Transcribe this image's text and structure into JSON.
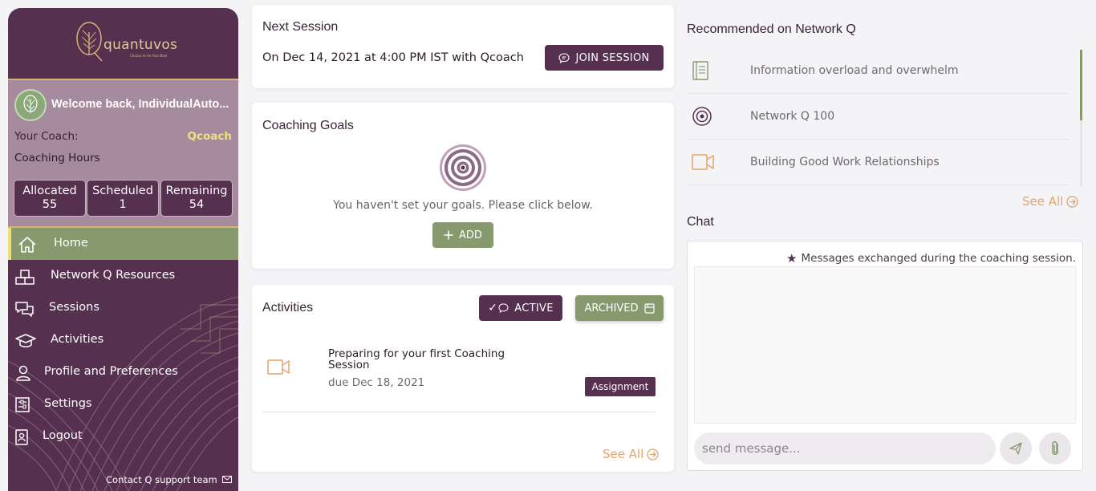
{
  "brand": {
    "name": "quantuvos",
    "tagline": "Choose to be Your Best"
  },
  "user": {
    "welcome": "Welcome back, IndividualAuto...",
    "coach_label": "Your Coach:",
    "coach_name": "Qcoach"
  },
  "hours": {
    "label": "Coaching Hours",
    "items": [
      {
        "label": "Allocated",
        "value": "55"
      },
      {
        "label": "Scheduled",
        "value": "1"
      },
      {
        "label": "Remaining",
        "value": "54"
      }
    ]
  },
  "nav": {
    "items": [
      {
        "label": "Home",
        "icon": "home-icon",
        "active": true
      },
      {
        "label": "Network Q Resources",
        "icon": "resources-icon",
        "active": false
      },
      {
        "label": "Sessions",
        "icon": "chat-bubbles-icon",
        "active": false
      },
      {
        "label": "Activities",
        "icon": "graduation-cap-icon",
        "active": false
      },
      {
        "label": "Profile and Preferences",
        "icon": "person-icon",
        "active": false
      },
      {
        "label": "Settings",
        "icon": "settings-sliders-icon",
        "active": false
      },
      {
        "label": "Logout",
        "icon": "logout-badge-icon",
        "active": false
      }
    ]
  },
  "contact_support": "Contact Q support team",
  "next_session": {
    "title": "Next Session",
    "text": "On Dec 14, 2021 at 4:00 PM IST with Qcoach",
    "join_label": "JOIN SESSION"
  },
  "coaching_goals": {
    "title": "Coaching Goals",
    "empty_text": "You haven't set your goals. Please click below.",
    "add_label": "ADD"
  },
  "activities": {
    "title": "Activities",
    "active_label": "ACTIVE",
    "archived_label": "ARCHIVED",
    "items": [
      {
        "title": "Preparing for your first Coaching Session",
        "due": "due Dec 18, 2021",
        "badge": "Assignment",
        "icon": "video-icon"
      }
    ],
    "see_all": "See All"
  },
  "recommended": {
    "title": "Recommended on Network Q",
    "items": [
      {
        "label": "Information overload and overwhelm",
        "icon": "book-icon"
      },
      {
        "label": "Network Q 100",
        "icon": "target-icon"
      },
      {
        "label": "Building Good Work Relationships",
        "icon": "video-icon"
      }
    ],
    "see_all": "See All"
  },
  "chat": {
    "title": "Chat",
    "note": "Messages exchanged during the coaching session.",
    "placeholder": "send message..."
  },
  "colors": {
    "primary": "#56304f",
    "accent_green": "#879a6e",
    "accent_orange": "#e2a46e",
    "gold": "#d9b278"
  }
}
